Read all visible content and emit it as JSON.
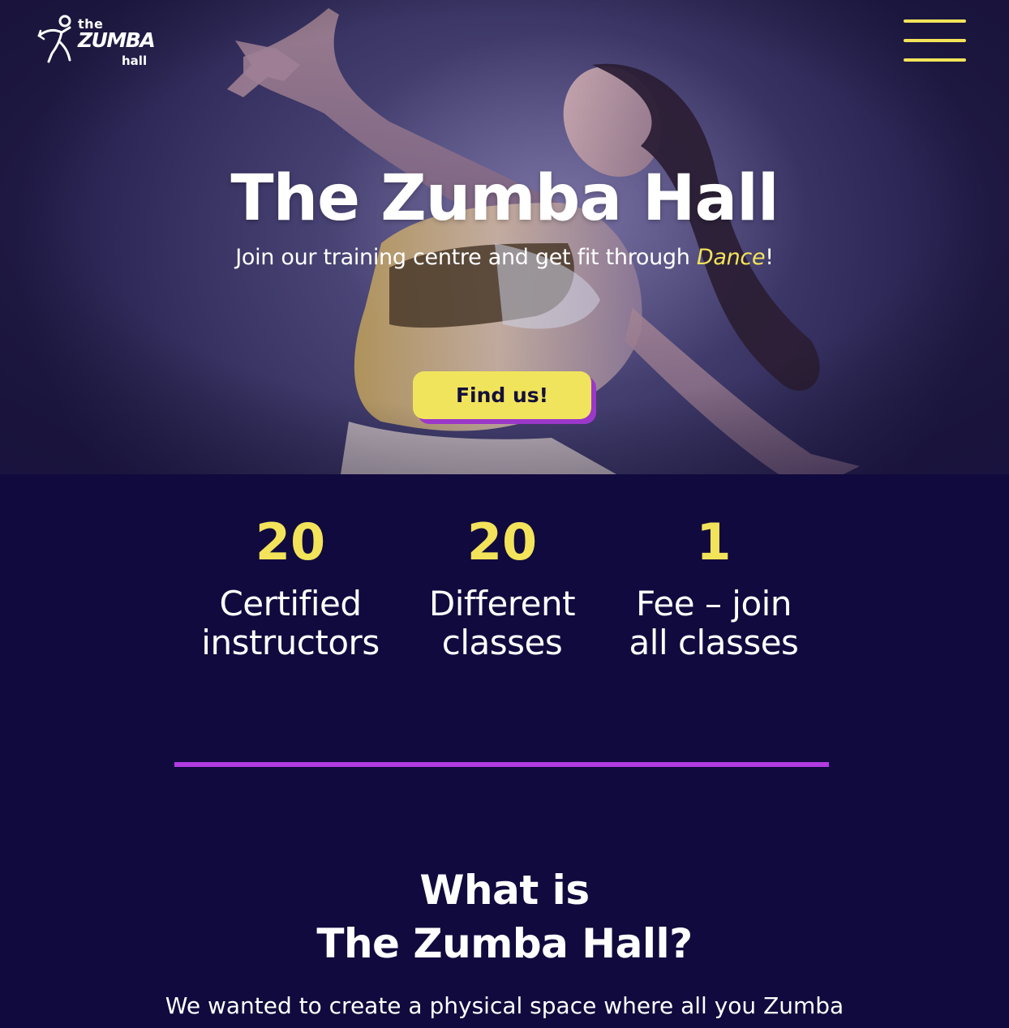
{
  "brand": {
    "logo_the": "the",
    "logo_zumba": "ZUMBA",
    "logo_hall": "hall",
    "accent_yellow": "#f2e35a",
    "accent_purple": "#b23be2",
    "background_navy": "#110a3e"
  },
  "header": {
    "menu_icon": "hamburger-menu-icon"
  },
  "hero": {
    "title": "The Zumba Hall",
    "subtitle_prefix": "Join our training centre and get fit through ",
    "subtitle_highlight": "Dance",
    "subtitle_suffix": "!",
    "cta_label": "Find us!"
  },
  "stats": [
    {
      "number": "20",
      "label_line1": "Certified",
      "label_line2": "instructors"
    },
    {
      "number": "20",
      "label_line1": "Different",
      "label_line2": "classes"
    },
    {
      "number": "1",
      "label_line1": "Fee – join",
      "label_line2": "all classes"
    }
  ],
  "about": {
    "title_line1": "What is",
    "title_line2": "The Zumba Hall?",
    "text": "We wanted to create a physical space where all you Zumba"
  }
}
